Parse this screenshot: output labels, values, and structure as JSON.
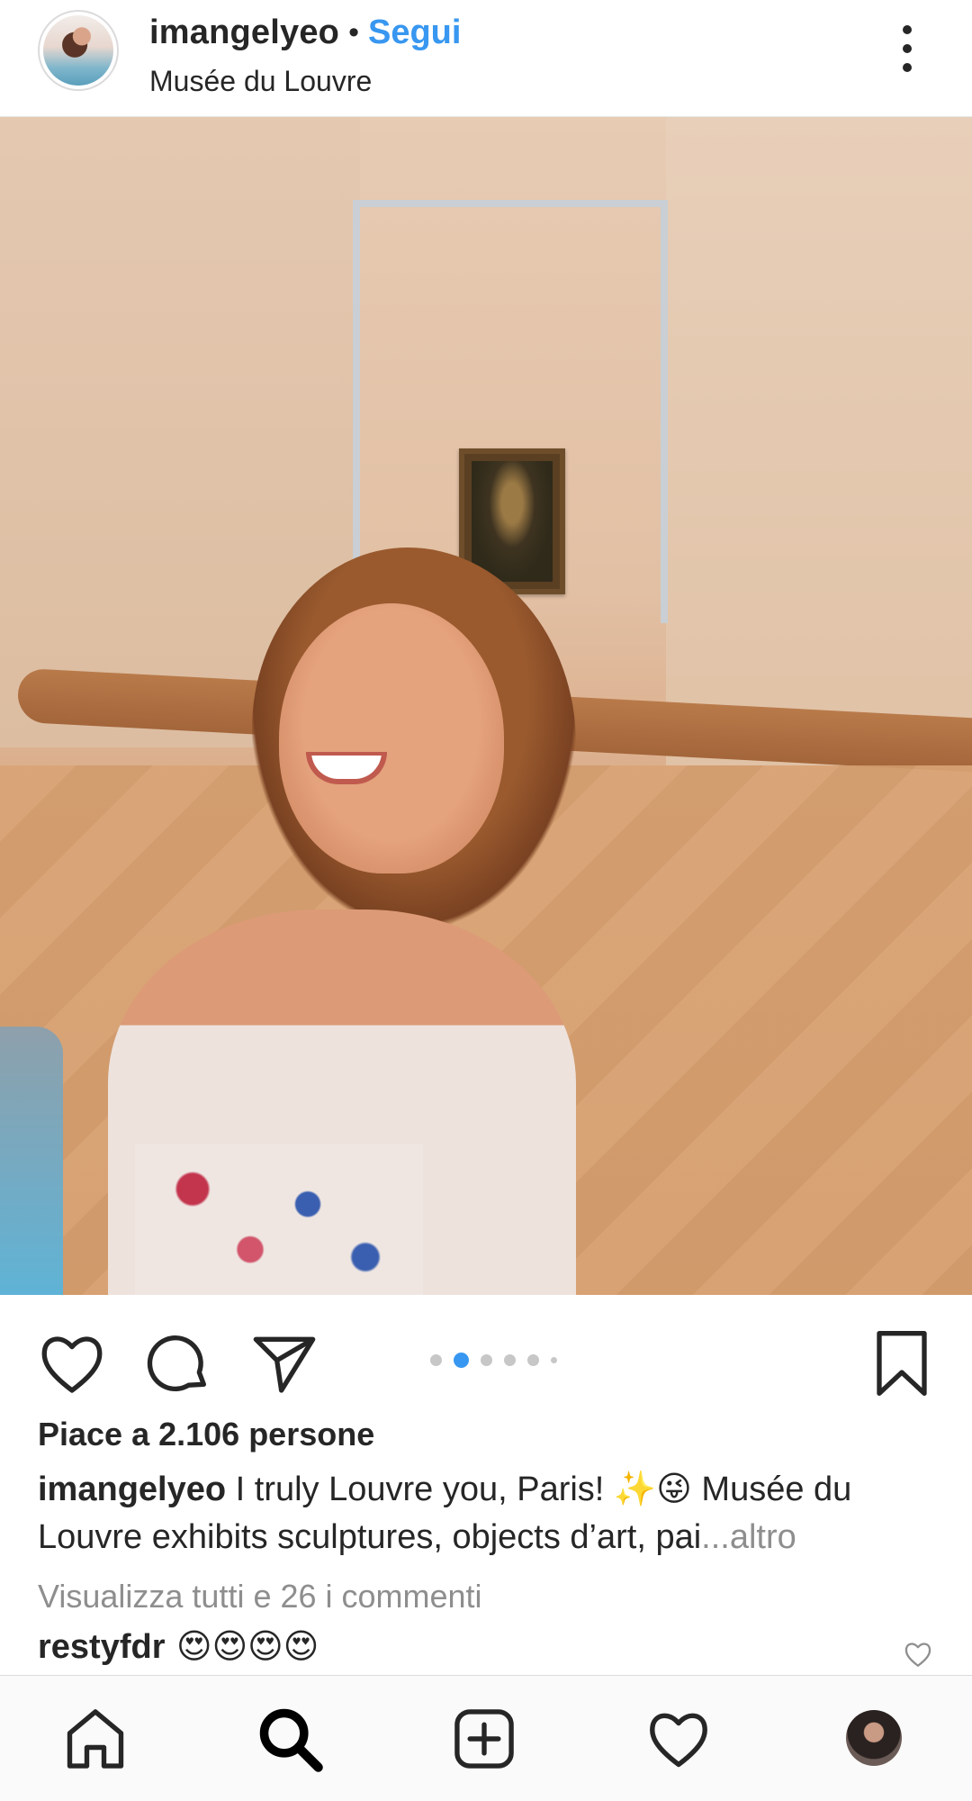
{
  "header": {
    "username": "imangelyeo",
    "separator": "•",
    "follow_label": "Segui",
    "location": "Musée du Louvre",
    "more_icon": "more-vertical-icon"
  },
  "post": {
    "carousel": {
      "total": 6,
      "active_index": 1
    },
    "likes_text": "Piace a 2.106 persone",
    "caption": {
      "username": "imangelyeo",
      "text": "I truly Louvre you, Paris! ✨😜 Musée du Louvre exhibits sculptures, objects d’art, pai",
      "more_label": "...altro"
    },
    "view_comments_label": "Visualizza tutti e 26 i commenti",
    "top_comment": {
      "username": "restyfdr",
      "text": "😍😍😍😍"
    }
  },
  "actions": {
    "icons": [
      "heart-icon",
      "comment-icon",
      "share-icon",
      "bookmark-icon"
    ]
  },
  "bottom_nav": {
    "items": [
      "home-icon",
      "search-icon",
      "add-post-icon",
      "activity-heart-icon",
      "profile-avatar"
    ]
  },
  "colors": {
    "accent": "#3897f0",
    "text": "#262626",
    "muted": "#8e8e8e"
  }
}
